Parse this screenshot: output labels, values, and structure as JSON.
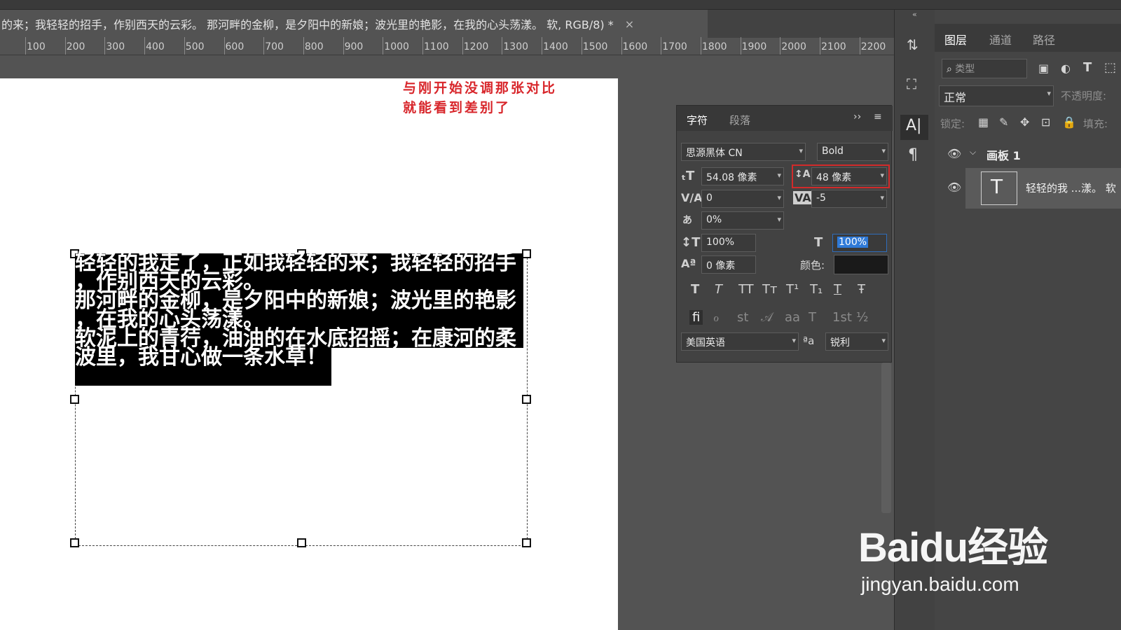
{
  "document": {
    "tab_title": "的来；我轻轻的招手，作别西天的云彩。 那河畔的金柳，是夕阳中的新娘；波光里的艳影，在我的心头荡漾。 软, RGB/8) *",
    "close_glyph": "×"
  },
  "ruler": {
    "ticks": [
      "100",
      "200",
      "300",
      "400",
      "500",
      "600",
      "700",
      "800",
      "900",
      "1000",
      "1100",
      "1200",
      "1300",
      "1400",
      "1500",
      "1600",
      "1700",
      "1800",
      "1900",
      "2000",
      "2100",
      "2200"
    ]
  },
  "canvas": {
    "annotation_lines": [
      "与刚开始没调那张对比",
      "就能看到差别了"
    ],
    "selected_text_lines": [
      "轻轻的我走了，正如我轻轻的来；我轻轻的招手",
      "，作别西天的云彩。",
      "那河畔的金柳，是夕阳中的新娘；波光里的艳影",
      "，在我的心头荡漾。",
      "软泥上的青荇，油油的在水底招摇；在康河的柔",
      "波里，我甘心做一条水草！"
    ]
  },
  "char_panel": {
    "tabs": [
      "字符",
      "段落"
    ],
    "font_family": "思源黑体 CN",
    "font_style": "Bold",
    "font_size": "54.08 像素",
    "leading": "48 像素",
    "kerning": "0",
    "tracking": "-5",
    "tsume": "0%",
    "vertical_scale": "100%",
    "horizontal_scale": "100%",
    "baseline_shift": "0 像素",
    "color_label": "颜色:",
    "color_value": "#1a1a1a",
    "style_buttons": [
      "T",
      "T",
      "TT",
      "Tт",
      "T¹",
      "T₁",
      "T",
      "Ŧ"
    ],
    "opentype_buttons": [
      "fi",
      "ℴ",
      "st",
      "𝒜",
      "aa",
      "T",
      "1st",
      "½"
    ],
    "language": "美国英语",
    "aa_label": "ªa",
    "antialias": "锐利",
    "highlight_color": "#d12a2a"
  },
  "layers_panel": {
    "tabs": [
      "图层",
      "通道",
      "路径"
    ],
    "search_placeholder": "类型",
    "blend_mode": "正常",
    "opacity_label": "不透明度:",
    "lock_label": "锁定:",
    "fill_label": "填充:",
    "artboard_name": "画板 1",
    "text_layer_name": "轻轻的我 ...漾。 软"
  },
  "watermark": {
    "brand": "Baidu经验",
    "url": "jingyan.baidu.com"
  }
}
